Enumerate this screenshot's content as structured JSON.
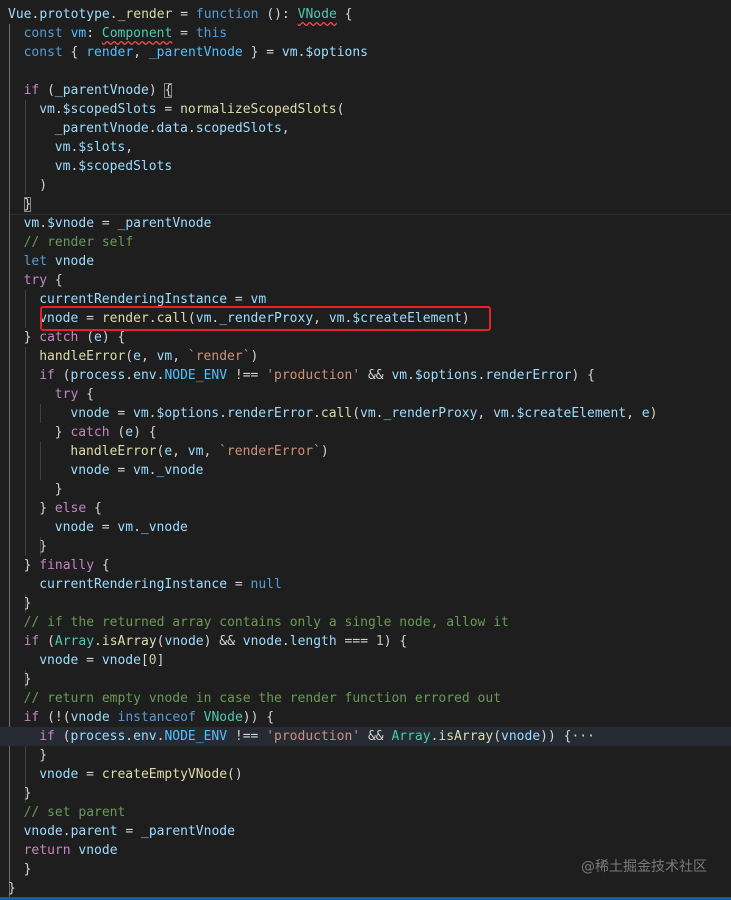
{
  "editor": {
    "lines": [
      {
        "indent": 0,
        "tokens": [
          [
            "Vue",
            "var"
          ],
          [
            ".",
            ""
          ],
          [
            "prototype",
            "var"
          ],
          [
            ".",
            ""
          ],
          [
            "_render",
            "fn"
          ],
          [
            " = ",
            ""
          ],
          [
            "function",
            "kw"
          ],
          [
            " (): ",
            ""
          ],
          [
            "VNode",
            "type",
            "squiggle"
          ],
          [
            " {",
            ""
          ]
        ]
      },
      {
        "indent": 1,
        "tokens": [
          [
            "const",
            "kw"
          ],
          [
            " ",
            ""
          ],
          [
            "vm",
            "const"
          ],
          [
            ": ",
            ""
          ],
          [
            "Component",
            "type",
            "squiggle"
          ],
          [
            " = ",
            ""
          ],
          [
            "this",
            "kw"
          ]
        ]
      },
      {
        "indent": 1,
        "tokens": [
          [
            "const",
            "kw"
          ],
          [
            " { ",
            ""
          ],
          [
            "render",
            "const"
          ],
          [
            ", ",
            ""
          ],
          [
            "_parentVnode",
            "const"
          ],
          [
            " } = ",
            ""
          ],
          [
            "vm",
            "var"
          ],
          [
            ".",
            ""
          ],
          [
            "$options",
            "var"
          ]
        ]
      },
      {
        "indent": 0,
        "tokens": []
      },
      {
        "indent": 1,
        "tokens": [
          [
            "if",
            "ctl"
          ],
          [
            " (",
            ""
          ],
          [
            "_parentVnode",
            "var"
          ],
          [
            ") ",
            ""
          ],
          [
            "{",
            "",
            "bracket"
          ]
        ]
      },
      {
        "indent": 2,
        "tokens": [
          [
            "vm",
            "var"
          ],
          [
            ".",
            ""
          ],
          [
            "$scopedSlots",
            "var"
          ],
          [
            " = ",
            ""
          ],
          [
            "normalizeScopedSlots",
            "fn"
          ],
          [
            "(",
            ""
          ]
        ]
      },
      {
        "indent": 3,
        "tokens": [
          [
            "_parentVnode",
            "var"
          ],
          [
            ".",
            ""
          ],
          [
            "data",
            "var"
          ],
          [
            ".",
            ""
          ],
          [
            "scopedSlots",
            "var"
          ],
          [
            ",",
            ""
          ]
        ]
      },
      {
        "indent": 3,
        "tokens": [
          [
            "vm",
            "var"
          ],
          [
            ".",
            ""
          ],
          [
            "$slots",
            "var"
          ],
          [
            ",",
            ""
          ]
        ]
      },
      {
        "indent": 3,
        "tokens": [
          [
            "vm",
            "var"
          ],
          [
            ".",
            ""
          ],
          [
            "$scopedSlots",
            "var"
          ]
        ]
      },
      {
        "indent": 2,
        "tokens": [
          [
            ")",
            ""
          ]
        ]
      },
      {
        "indent": 1,
        "tokens": [
          [
            "}",
            "",
            "bracket"
          ]
        ]
      },
      {
        "indent": 1,
        "tokens": [
          [
            "vm",
            "var"
          ],
          [
            ".",
            ""
          ],
          [
            "$vnode",
            "var"
          ],
          [
            " = ",
            ""
          ],
          [
            "_parentVnode",
            "var"
          ]
        ]
      },
      {
        "indent": 1,
        "tokens": [
          [
            "// render self",
            "com"
          ]
        ]
      },
      {
        "indent": 1,
        "tokens": [
          [
            "let",
            "kw"
          ],
          [
            " ",
            ""
          ],
          [
            "vnode",
            "var"
          ]
        ]
      },
      {
        "indent": 1,
        "tokens": [
          [
            "try",
            "ctl"
          ],
          [
            " {",
            ""
          ]
        ]
      },
      {
        "indent": 2,
        "tokens": [
          [
            "currentRenderingInstance",
            "var"
          ],
          [
            " = ",
            ""
          ],
          [
            "vm",
            "var"
          ]
        ]
      },
      {
        "indent": 2,
        "tokens": [
          [
            "vnode",
            "var"
          ],
          [
            " = ",
            ""
          ],
          [
            "render",
            "fn"
          ],
          [
            ".",
            ""
          ],
          [
            "call",
            "fn"
          ],
          [
            "(",
            ""
          ],
          [
            "vm",
            "var"
          ],
          [
            ".",
            ""
          ],
          [
            "_renderProxy",
            "var"
          ],
          [
            ", ",
            ""
          ],
          [
            "vm",
            "var"
          ],
          [
            ".",
            ""
          ],
          [
            "$createElement",
            "var"
          ],
          [
            ")",
            ""
          ]
        ]
      },
      {
        "indent": 1,
        "tokens": [
          [
            "} ",
            ""
          ],
          [
            "catch",
            "ctl"
          ],
          [
            " (",
            ""
          ],
          [
            "e",
            "var"
          ],
          [
            ") {",
            ""
          ]
        ]
      },
      {
        "indent": 2,
        "tokens": [
          [
            "handleError",
            "fn"
          ],
          [
            "(",
            ""
          ],
          [
            "e",
            "var"
          ],
          [
            ", ",
            ""
          ],
          [
            "vm",
            "var"
          ],
          [
            ", ",
            ""
          ],
          [
            "`render`",
            "str"
          ],
          [
            ")",
            ""
          ]
        ]
      },
      {
        "indent": 2,
        "tokens": [
          [
            "if",
            "ctl"
          ],
          [
            " (",
            ""
          ],
          [
            "process",
            "var"
          ],
          [
            ".",
            ""
          ],
          [
            "env",
            "var"
          ],
          [
            ".",
            ""
          ],
          [
            "NODE_ENV",
            "const"
          ],
          [
            " !== ",
            ""
          ],
          [
            "'production'",
            "str"
          ],
          [
            " && ",
            ""
          ],
          [
            "vm",
            "var"
          ],
          [
            ".",
            ""
          ],
          [
            "$options",
            "var"
          ],
          [
            ".",
            ""
          ],
          [
            "renderError",
            "var"
          ],
          [
            ") {",
            ""
          ]
        ]
      },
      {
        "indent": 3,
        "tokens": [
          [
            "try",
            "ctl"
          ],
          [
            " {",
            ""
          ]
        ]
      },
      {
        "indent": 4,
        "tokens": [
          [
            "vnode",
            "var"
          ],
          [
            " = ",
            ""
          ],
          [
            "vm",
            "var"
          ],
          [
            ".",
            ""
          ],
          [
            "$options",
            "var"
          ],
          [
            ".",
            ""
          ],
          [
            "renderError",
            "var"
          ],
          [
            ".",
            ""
          ],
          [
            "call",
            "fn"
          ],
          [
            "(",
            ""
          ],
          [
            "vm",
            "var"
          ],
          [
            ".",
            ""
          ],
          [
            "_renderProxy",
            "var"
          ],
          [
            ", ",
            ""
          ],
          [
            "vm",
            "var"
          ],
          [
            ".",
            ""
          ],
          [
            "$createElement",
            "var"
          ],
          [
            ", ",
            ""
          ],
          [
            "e",
            "var"
          ],
          [
            ")",
            ""
          ]
        ]
      },
      {
        "indent": 3,
        "tokens": [
          [
            "} ",
            ""
          ],
          [
            "catch",
            "ctl"
          ],
          [
            " (",
            ""
          ],
          [
            "e",
            "var"
          ],
          [
            ") {",
            ""
          ]
        ]
      },
      {
        "indent": 4,
        "tokens": [
          [
            "handleError",
            "fn"
          ],
          [
            "(",
            ""
          ],
          [
            "e",
            "var"
          ],
          [
            ", ",
            ""
          ],
          [
            "vm",
            "var"
          ],
          [
            ", ",
            ""
          ],
          [
            "`renderError`",
            "str"
          ],
          [
            ")",
            ""
          ]
        ]
      },
      {
        "indent": 4,
        "tokens": [
          [
            "vnode",
            "var"
          ],
          [
            " = ",
            ""
          ],
          [
            "vm",
            "var"
          ],
          [
            ".",
            ""
          ],
          [
            "_vnode",
            "var"
          ]
        ]
      },
      {
        "indent": 3,
        "tokens": [
          [
            "}",
            ""
          ]
        ]
      },
      {
        "indent": 2,
        "tokens": [
          [
            "} ",
            ""
          ],
          [
            "else",
            "ctl"
          ],
          [
            " {",
            ""
          ]
        ]
      },
      {
        "indent": 3,
        "tokens": [
          [
            "vnode",
            "var"
          ],
          [
            " = ",
            ""
          ],
          [
            "vm",
            "var"
          ],
          [
            ".",
            ""
          ],
          [
            "_vnode",
            "var"
          ]
        ]
      },
      {
        "indent": 2,
        "tokens": [
          [
            "}",
            ""
          ]
        ]
      },
      {
        "indent": 1,
        "tokens": [
          [
            "} ",
            ""
          ],
          [
            "finally",
            "ctl"
          ],
          [
            " {",
            ""
          ]
        ]
      },
      {
        "indent": 2,
        "tokens": [
          [
            "currentRenderingInstance",
            "var"
          ],
          [
            " = ",
            ""
          ],
          [
            "null",
            "kw"
          ]
        ]
      },
      {
        "indent": 1,
        "tokens": [
          [
            "}",
            ""
          ]
        ]
      },
      {
        "indent": 1,
        "tokens": [
          [
            "// if the returned array contains only a single node, allow it",
            "com"
          ]
        ]
      },
      {
        "indent": 1,
        "tokens": [
          [
            "if",
            "ctl"
          ],
          [
            " (",
            ""
          ],
          [
            "Array",
            "type"
          ],
          [
            ".",
            ""
          ],
          [
            "isArray",
            "fn"
          ],
          [
            "(",
            ""
          ],
          [
            "vnode",
            "var"
          ],
          [
            ") && ",
            ""
          ],
          [
            "vnode",
            "var"
          ],
          [
            ".",
            ""
          ],
          [
            "length",
            "var"
          ],
          [
            " === ",
            ""
          ],
          [
            "1",
            "num"
          ],
          [
            ") {",
            ""
          ]
        ]
      },
      {
        "indent": 2,
        "tokens": [
          [
            "vnode",
            "var"
          ],
          [
            " = ",
            ""
          ],
          [
            "vnode",
            "var"
          ],
          [
            "[",
            ""
          ],
          [
            "0",
            "num"
          ],
          [
            "]",
            ""
          ]
        ]
      },
      {
        "indent": 1,
        "tokens": [
          [
            "}",
            ""
          ]
        ]
      },
      {
        "indent": 1,
        "tokens": [
          [
            "// return empty vnode in case the render function errored out",
            "com"
          ]
        ]
      },
      {
        "indent": 1,
        "tokens": [
          [
            "if",
            "ctl"
          ],
          [
            " (!(",
            ""
          ],
          [
            "vnode",
            "var"
          ],
          [
            " ",
            ""
          ],
          [
            "instanceof",
            "kw"
          ],
          [
            " ",
            ""
          ],
          [
            "VNode",
            "type"
          ],
          [
            ")) {",
            ""
          ]
        ]
      },
      {
        "indent": 2,
        "tokens": [
          [
            "if",
            "ctl"
          ],
          [
            " (",
            ""
          ],
          [
            "process",
            "var"
          ],
          [
            ".",
            ""
          ],
          [
            "env",
            "var"
          ],
          [
            ".",
            ""
          ],
          [
            "NODE_ENV",
            "const"
          ],
          [
            " !== ",
            ""
          ],
          [
            "'production'",
            "str"
          ],
          [
            " && ",
            ""
          ],
          [
            "Array",
            "type"
          ],
          [
            ".",
            ""
          ],
          [
            "isArray",
            "fn"
          ],
          [
            "(",
            ""
          ],
          [
            "vnode",
            "var"
          ],
          [
            ")) {",
            ""
          ],
          [
            "···",
            "",
            "ellipsis"
          ]
        ],
        "highlight": true
      },
      {
        "indent": 2,
        "tokens": [
          [
            "}",
            ""
          ]
        ]
      },
      {
        "indent": 2,
        "tokens": [
          [
            "vnode",
            "var"
          ],
          [
            " = ",
            ""
          ],
          [
            "createEmptyVNode",
            "fn"
          ],
          [
            "()",
            ""
          ]
        ]
      },
      {
        "indent": 1,
        "tokens": [
          [
            "}",
            ""
          ]
        ]
      },
      {
        "indent": 1,
        "tokens": [
          [
            "// set parent",
            "com"
          ]
        ]
      },
      {
        "indent": 1,
        "tokens": [
          [
            "vnode",
            "var"
          ],
          [
            ".",
            ""
          ],
          [
            "parent",
            "var"
          ],
          [
            " = ",
            ""
          ],
          [
            "_parentVnode",
            "var"
          ]
        ]
      },
      {
        "indent": 1,
        "tokens": [
          [
            "return",
            "ctl"
          ],
          [
            " ",
            ""
          ],
          [
            "vnode",
            "var"
          ]
        ]
      },
      {
        "indent": 1,
        "tokens": [
          [
            "}",
            ""
          ]
        ]
      },
      {
        "indent": 0,
        "tokens": [
          [
            "}",
            ""
          ]
        ]
      }
    ]
  },
  "colors": {
    "background": "#1e1e1e",
    "callout": "#e0242a",
    "accent": "#0e639c"
  },
  "watermark": "@稀土掘金技术社区"
}
